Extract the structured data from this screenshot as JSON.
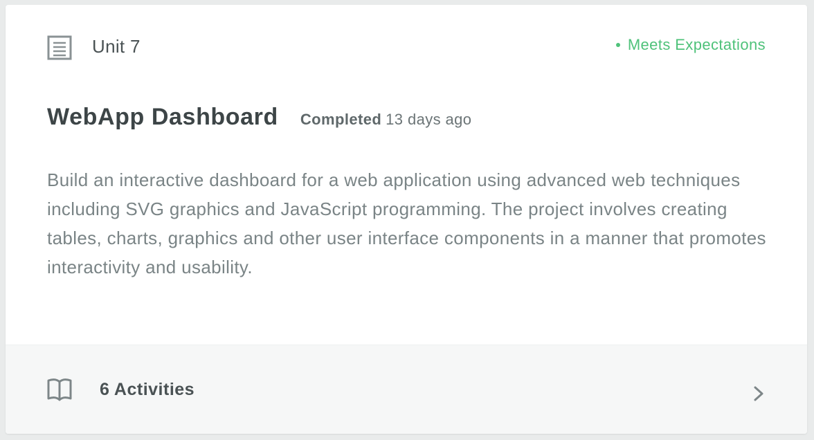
{
  "unit": {
    "title": "Unit 7",
    "icon": "document-icon"
  },
  "status": {
    "label": "Meets Expectations",
    "color": "#4fc27a"
  },
  "project": {
    "title": "WebApp Dashboard",
    "completed_label": "Completed",
    "completed_time": "13 days ago",
    "description": "Build an interactive dashboard for a web application using advanced web techniques including SVG graphics and JavaScript programming. The project involves creating tables, charts, graphics and other user interface components in a manner that promotes interactivity and usability."
  },
  "footer": {
    "activities_label": "6 Activities",
    "icon": "book-icon",
    "arrow_icon": "chevron-right-icon"
  }
}
